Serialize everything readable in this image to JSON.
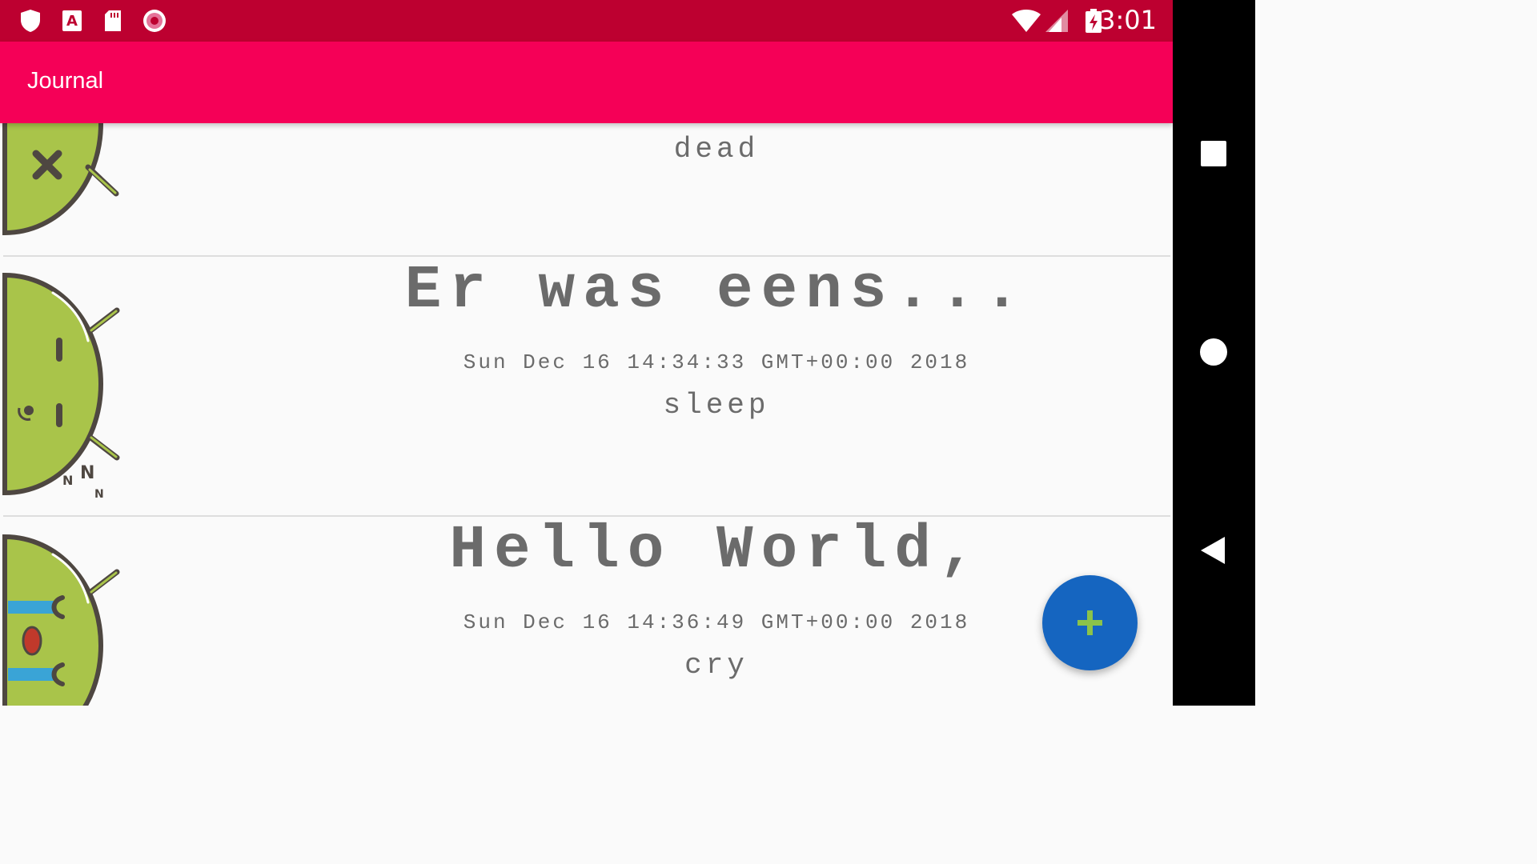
{
  "status_bar": {
    "time": "3:01",
    "icons": [
      "shield-icon",
      "font-download-icon",
      "sd-card-icon",
      "record-icon",
      "wifi-icon",
      "signal-icon",
      "battery-charging-icon"
    ],
    "color": "#bd0030"
  },
  "app_bar": {
    "title": "Journal",
    "color": "#f50057"
  },
  "entries": [
    {
      "title": "",
      "date": "",
      "mood": "dead",
      "avatar": "dead-android-icon"
    },
    {
      "title": "Er was eens...",
      "date": "Sun Dec 16 14:34:33 GMT+00:00 2018",
      "mood": "sleep",
      "avatar": "sleep-android-icon"
    },
    {
      "title": "Hello World,",
      "date": "Sun Dec 16 14:36:49 GMT+00:00 2018",
      "mood": "cry",
      "avatar": "cry-android-icon"
    }
  ],
  "fab": {
    "icon": "plus-icon",
    "color": "#1565c0",
    "icon_color": "#8bc34a"
  },
  "nav_bar": {
    "buttons": [
      "recents-square-icon",
      "home-circle-icon",
      "back-triangle-icon"
    ]
  }
}
